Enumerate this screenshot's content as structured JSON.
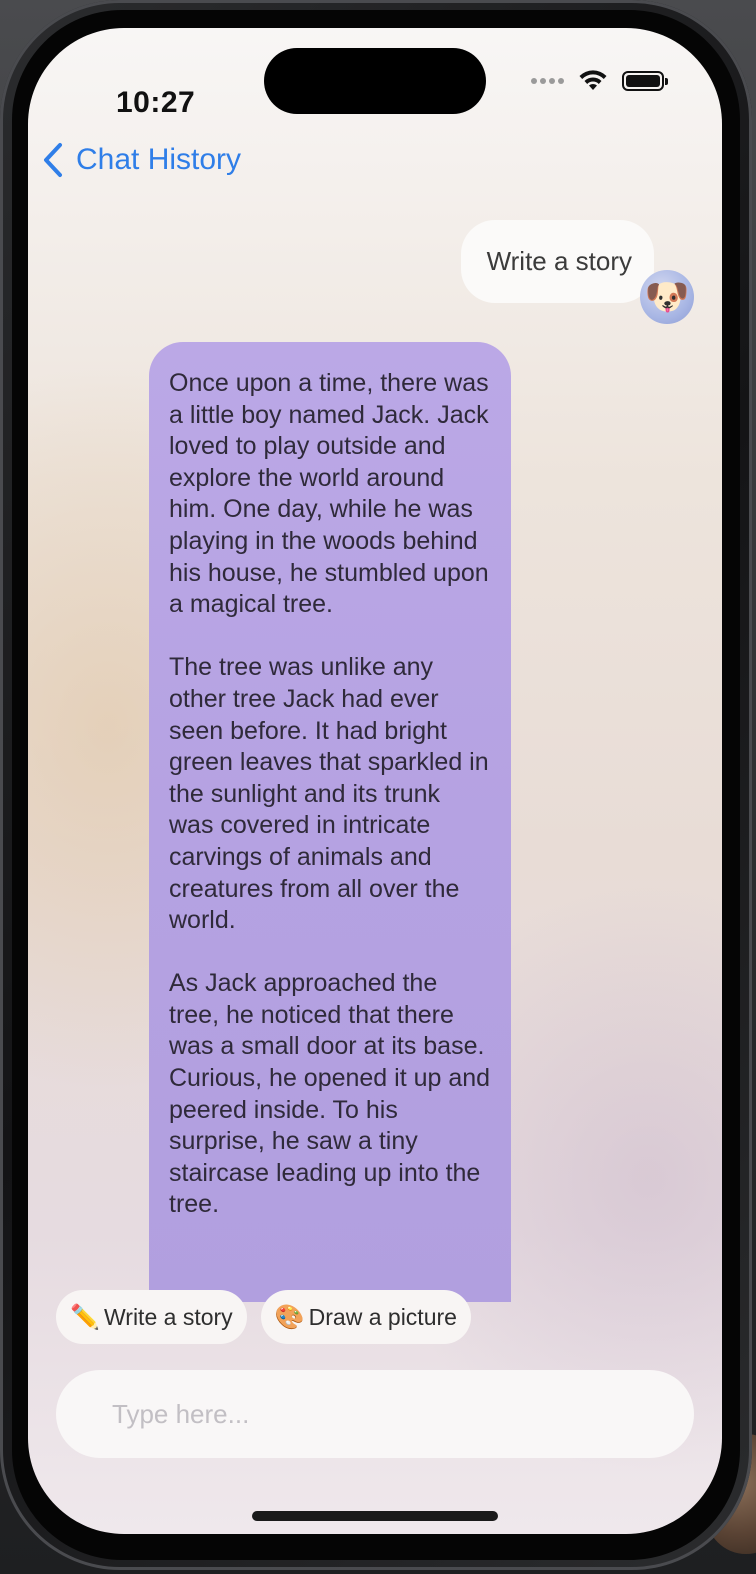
{
  "status_bar": {
    "time": "10:27"
  },
  "nav": {
    "back_label": "Chat History"
  },
  "messages": {
    "user_text": "Write a story",
    "user_avatar_emoji": "🐶",
    "ai_paragraphs": [
      "Once upon a time, there was a little boy named Jack. Jack loved to play outside and explore the world around him. One day, while he was playing in the woods behind his house, he stumbled upon a magical tree.",
      "The tree was unlike any other tree Jack had ever seen before. It had bright green leaves that sparkled in the sunlight and its trunk was covered in intricate carvings of animals and creatures from all over the world.",
      "As Jack approached the tree, he noticed that there was a small door at its base. Curious, he opened it up and peered inside. To his surprise, he saw a tiny staircase leading up into the tree."
    ]
  },
  "quick_actions": [
    {
      "icon": "✏️",
      "icon_name": "pencil-icon",
      "label": "Write a story"
    },
    {
      "icon": "🎨",
      "icon_name": "palette-icon",
      "label": "Draw a picture"
    }
  ],
  "input": {
    "placeholder": "Type here..."
  },
  "colors": {
    "accent": "#2f7ee8",
    "ai_bubble": "#b5a2e2",
    "user_bubble": "#fbfaf9"
  }
}
